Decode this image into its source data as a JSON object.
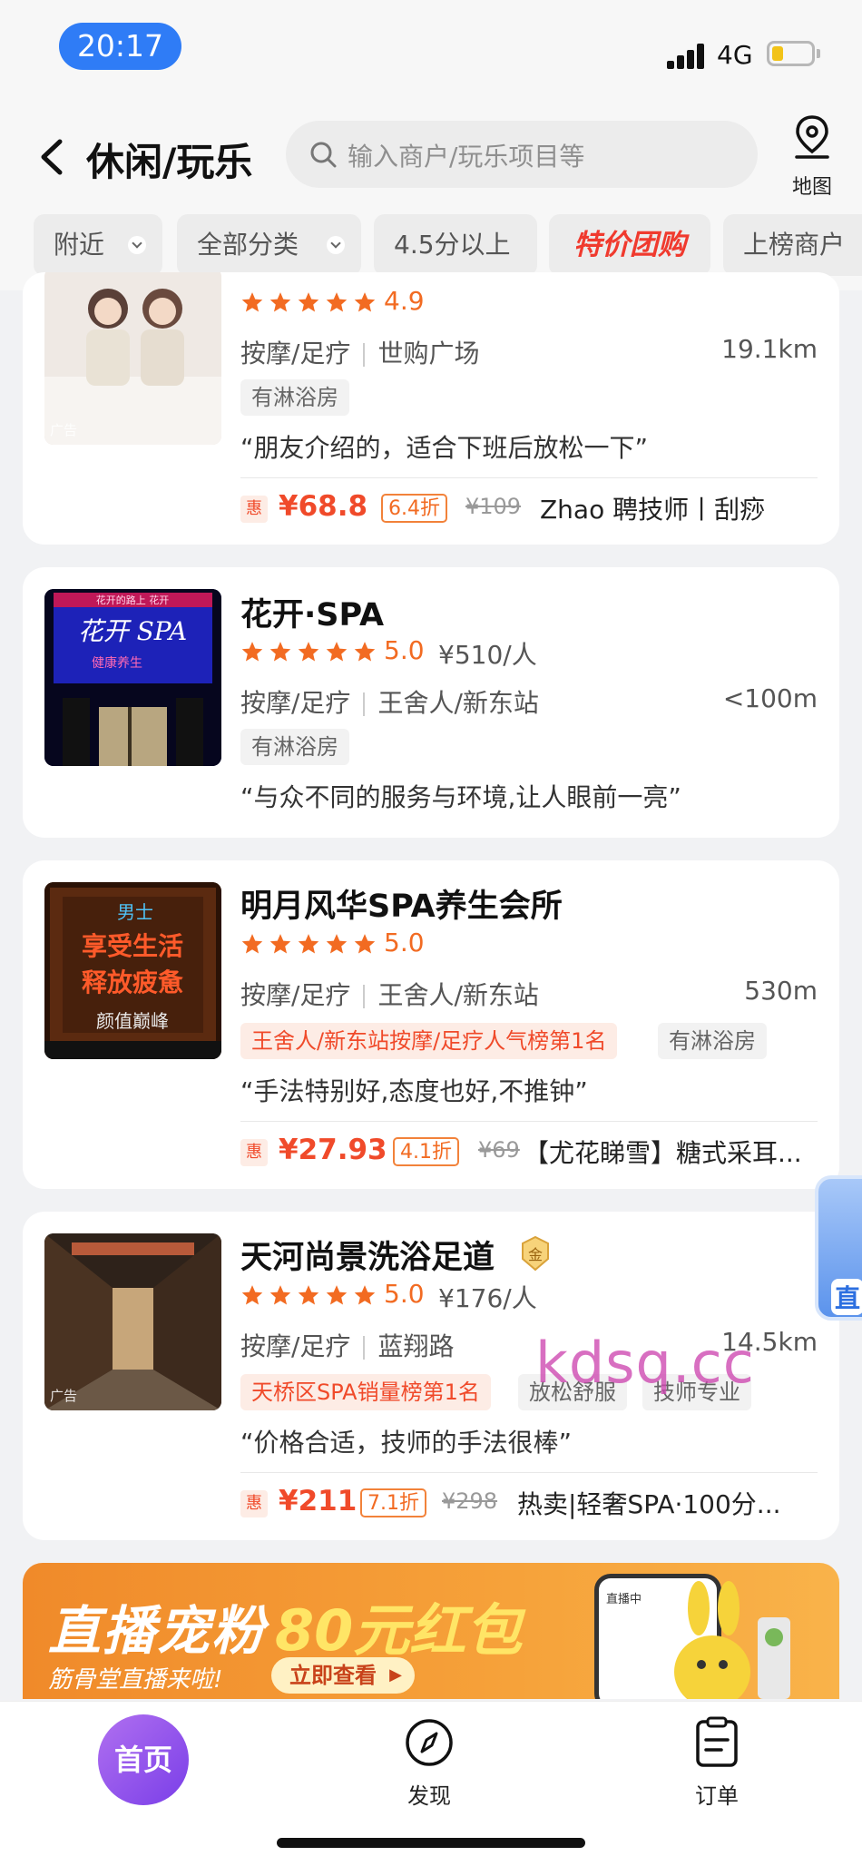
{
  "status_bar": {
    "time": "20:17",
    "network": "4G"
  },
  "header": {
    "title": "休闲/玩乐",
    "search_placeholder": "输入商户/玩乐项目等",
    "map_label": "地图"
  },
  "filters": [
    {
      "label": "附近",
      "dropdown": true
    },
    {
      "label": "全部分类",
      "dropdown": true
    },
    {
      "label": "4.5分以上",
      "dropdown": false
    },
    {
      "label": "特价团购",
      "dropdown": false,
      "highlight": true
    },
    {
      "label": "上榜商户",
      "dropdown": false
    }
  ],
  "cards": [
    {
      "ad_label": "广告",
      "stars": 5,
      "rating": "4.9",
      "category": "按摩/足疗",
      "area": "世购广场",
      "distance": "19.1km",
      "tags": [
        "有淋浴房"
      ],
      "review": "“朋友介绍的，适合下班后放松一下”",
      "deal": {
        "hui": "惠",
        "price": "¥68.8",
        "discount": "6.4折",
        "original": "¥109",
        "title": "Zhao 聘技师丨刮痧"
      }
    },
    {
      "name": "花开·SPA",
      "stars": 5,
      "rating": "5.0",
      "price_per_person": "¥510/人",
      "category": "按摩/足疗",
      "area": "王舍人/新东站",
      "distance": "<100m",
      "tags": [
        "有淋浴房"
      ],
      "review": "“与众不同的服务与环境,让人眼前一亮”"
    },
    {
      "name": "明月风华SPA养生会所",
      "stars": 5,
      "rating": "5.0",
      "category": "按摩/足疗",
      "area": "王舍人/新东站",
      "distance": "530m",
      "rank_tag": "王舍人/新东站按摩/足疗人气榜第1名",
      "tags": [
        "有淋浴房"
      ],
      "review": "“手法特别好,态度也好,不推钟”",
      "deal": {
        "hui": "惠",
        "price": "¥27.93",
        "discount": "4.1折",
        "original": "¥69",
        "title": "【尤花睇雪】糖式采耳..."
      }
    },
    {
      "name": "天河尚景洗浴足道",
      "badge": "金",
      "ad_label": "广告",
      "stars": 5,
      "rating": "5.0",
      "price_per_person": "¥176/人",
      "category": "按摩/足疗",
      "area": "蓝翔路",
      "distance": "14.5km",
      "rank_tag": "天桥区SPA销量榜第1名",
      "tags": [
        "放松舒服",
        "技师专业"
      ],
      "review": "“价格合适，技师的手法很棒”",
      "deal": {
        "hui": "惠",
        "price": "¥211",
        "discount": "7.1折",
        "original": "¥298",
        "title": "热卖|轻奢SPA·100分..."
      }
    }
  ],
  "thumbnails": {
    "card2_sign_top": "花开的路上 花开",
    "card2_sign_main": "花开 SPA",
    "card2_sign_sub": "健康养生",
    "card3_line1": "男士",
    "card3_line2": "享受生活",
    "card3_line3": "释放疲惫",
    "card3_line4": "颜值巅峰"
  },
  "banner": {
    "title": "直播宠粉",
    "amount": "80元红包",
    "subtitle": "筋骨堂直播来啦!",
    "button": "立即查看",
    "phone_label": "直播中"
  },
  "float_widget": {
    "label": "直"
  },
  "watermark": "kdsq.cc",
  "tabbar": {
    "home": "首页",
    "discover": "发现",
    "orders": "订单"
  },
  "colors": {
    "accent": "#f26b22",
    "price": "#f04a2a",
    "home_tab": "#8a4ef0",
    "time_pill": "#2f7cf6"
  }
}
